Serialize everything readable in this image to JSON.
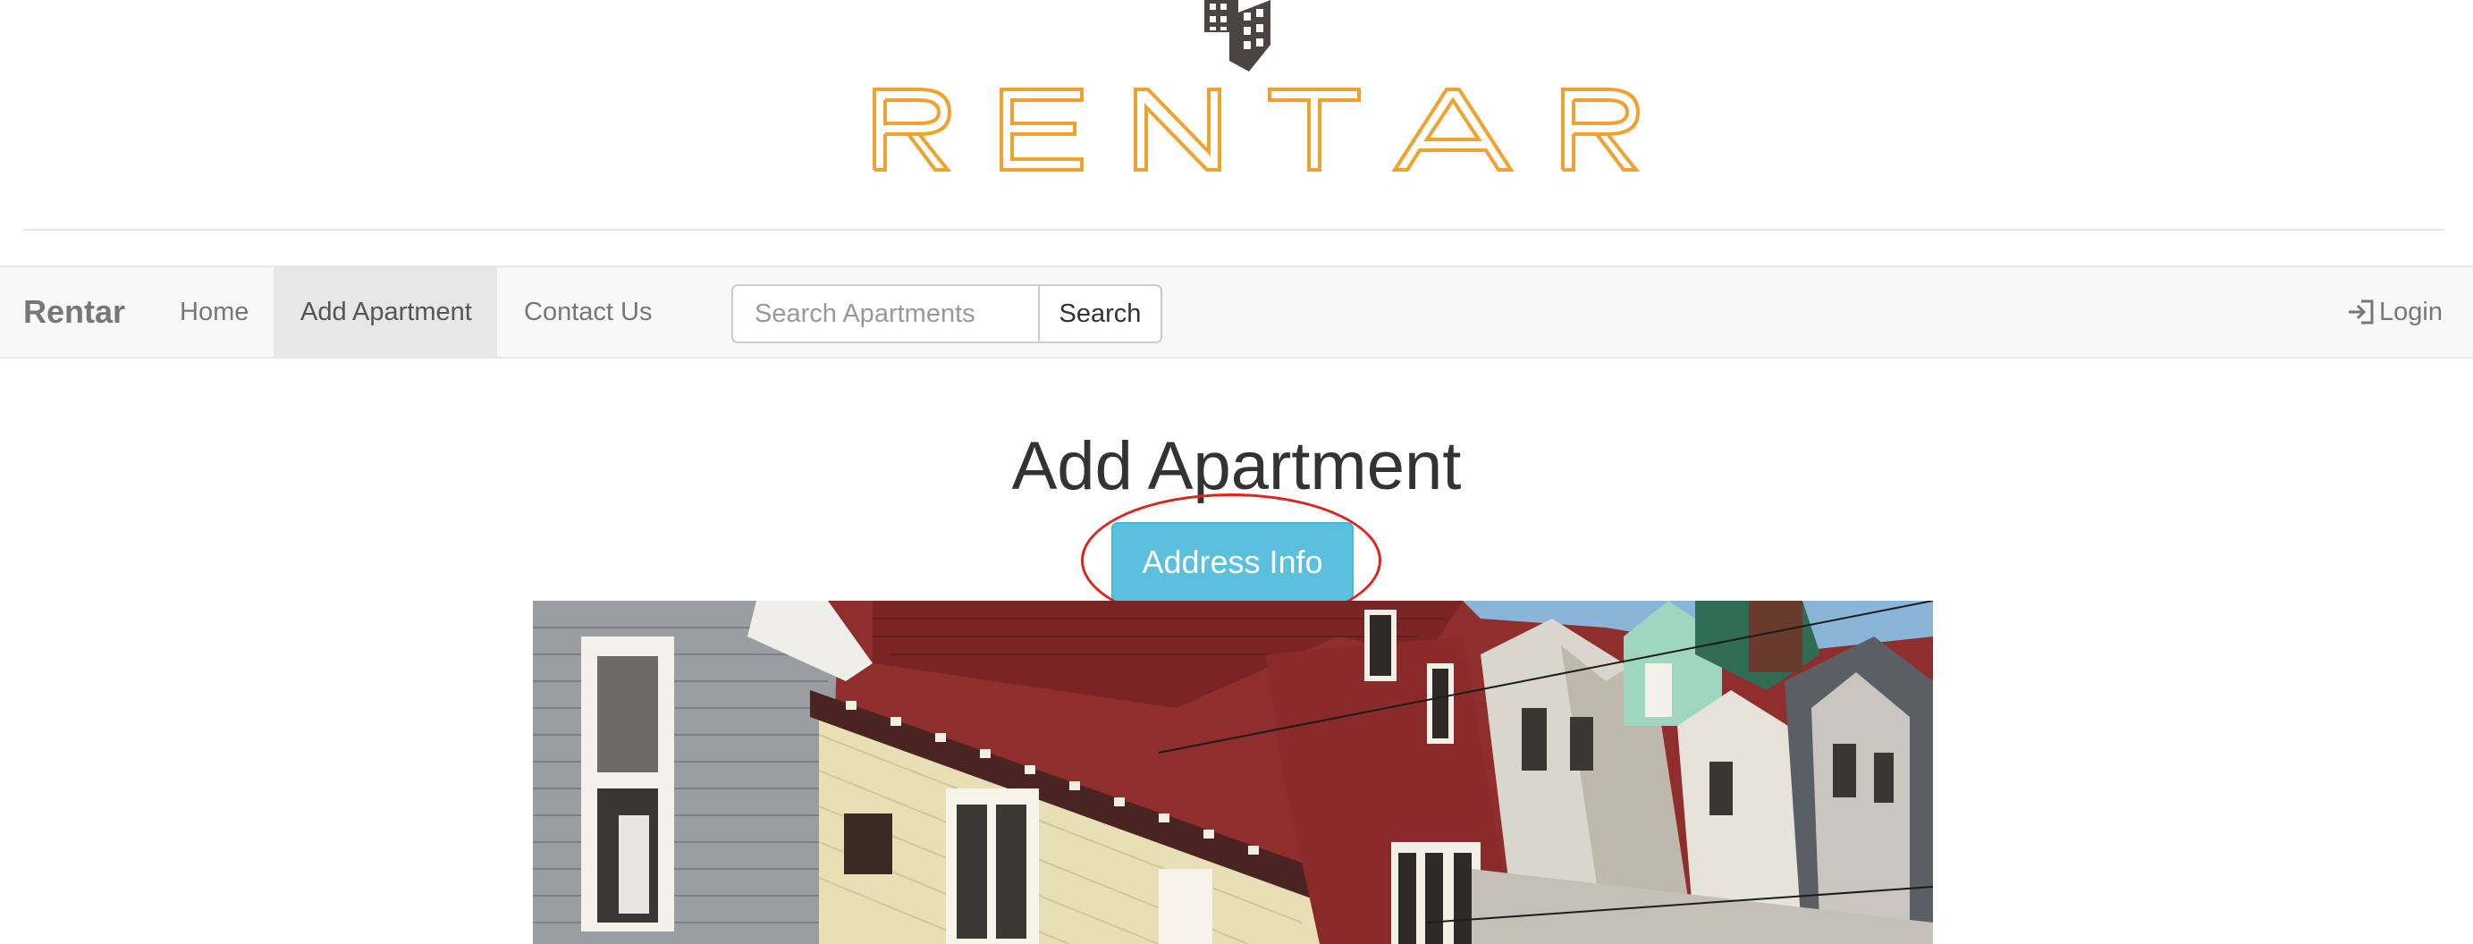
{
  "logo": {
    "wordmark": "RENTAR",
    "colors": {
      "wordmark": "#f2a12c",
      "building": "#4a4442"
    }
  },
  "navbar": {
    "brand": "Rentar",
    "links": [
      {
        "label": "Home",
        "active": false
      },
      {
        "label": "Add Apartment",
        "active": true
      },
      {
        "label": "Contact Us",
        "active": false
      }
    ],
    "search": {
      "placeholder": "Search Apartments",
      "value": "",
      "button_label": "Search"
    },
    "login": {
      "label": "Login",
      "icon": "sign-in-icon"
    }
  },
  "main": {
    "title": "Add Apartment",
    "address_button_label": "Address Info",
    "address_button_color": "#5bc0de",
    "highlight_color": "#e0231b",
    "hero_image": "row-houses-photo"
  }
}
